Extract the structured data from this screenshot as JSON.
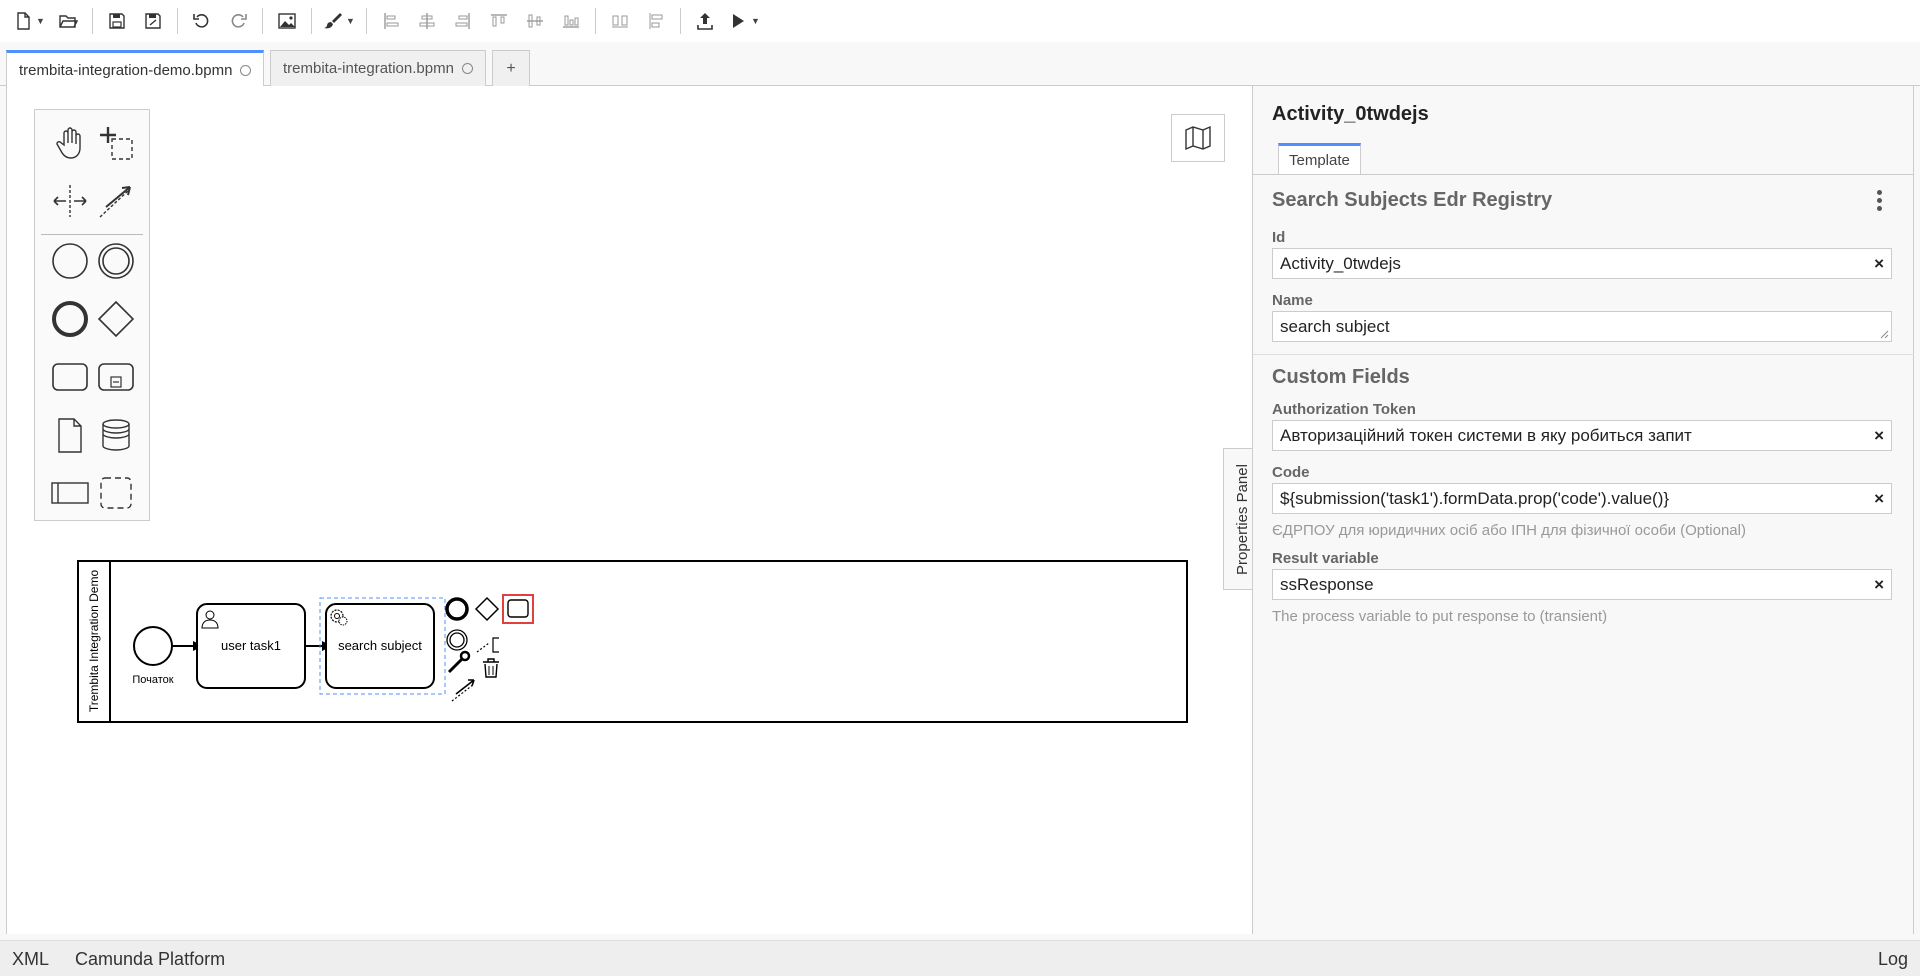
{
  "toolbar": {
    "buttons": [
      "new-file",
      "open-file",
      "save",
      "save-as",
      "undo",
      "redo",
      "export-image",
      "set-color",
      "align-left",
      "align-center",
      "align-right",
      "align-top",
      "align-middle",
      "align-bottom",
      "distribute-horizontally",
      "distribute-vertically",
      "deploy",
      "start-instance"
    ]
  },
  "tabs": [
    {
      "label": "trembita-integration-demo.bpmn",
      "active": true
    },
    {
      "label": "trembita-integration.bpmn",
      "active": false
    }
  ],
  "tab_add_label": "+",
  "diagram": {
    "pool_label": "Trembita Integration Demo",
    "start_event_label": "Початок",
    "user_task_label": "user task1",
    "service_task_label": "search subject"
  },
  "properties_toggle_label": "Properties Panel",
  "properties": {
    "title": "Activity_0twdejs",
    "tab": "Template",
    "template_name": "Search Subjects Edr Registry",
    "id_label": "Id",
    "id_value": "Activity_0twdejs",
    "name_label": "Name",
    "name_value": "search subject",
    "custom_fields_title": "Custom Fields",
    "auth_label": "Authorization Token",
    "auth_value": "Авторизаційний токен системи в яку робиться запит",
    "code_label": "Code",
    "code_value": "${submission('task1').formData.prop('code').value()}",
    "code_hint": "ЄДРПОУ для юридичних осіб або ІПН для фізичної особи (Optional)",
    "result_label": "Result variable",
    "result_value": "ssResponse",
    "result_hint": "The process variable to put response to (transient)",
    "clear_glyph": "×"
  },
  "statusbar": {
    "xml": "XML",
    "platform": "Camunda Platform",
    "log": "Log"
  },
  "colors": {
    "accent": "#4d90fe",
    "selection": "#4d90fe",
    "context_highlight": "#e04040"
  }
}
